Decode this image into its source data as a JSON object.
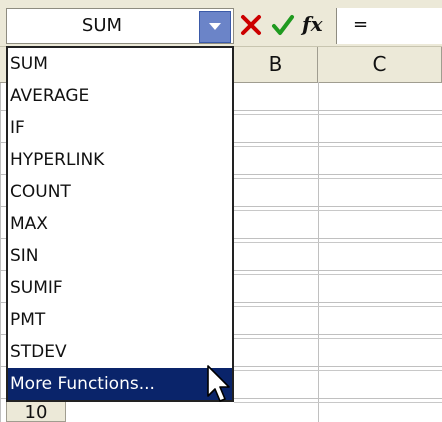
{
  "name_box": {
    "value": "SUM",
    "dropdown_icon": "chevron-down-icon"
  },
  "formula_bar": {
    "cancel_icon": "cancel-x-icon",
    "enter_icon": "checkmark-icon",
    "fx_label": "fx",
    "formula_text": "="
  },
  "columns": [
    "B",
    "C"
  ],
  "row_header": "10",
  "function_list": {
    "items": [
      "SUM",
      "AVERAGE",
      "IF",
      "HYPERLINK",
      "COUNT",
      "MAX",
      "SIN",
      "SUMIF",
      "PMT",
      "STDEV"
    ],
    "more": "More Functions..."
  },
  "colors": {
    "selection": "#0a246a",
    "dropdown_button": "#6b84c8",
    "cancel": "#cc0000",
    "enter": "#1f9a1f",
    "chrome": "#ece9d8"
  }
}
